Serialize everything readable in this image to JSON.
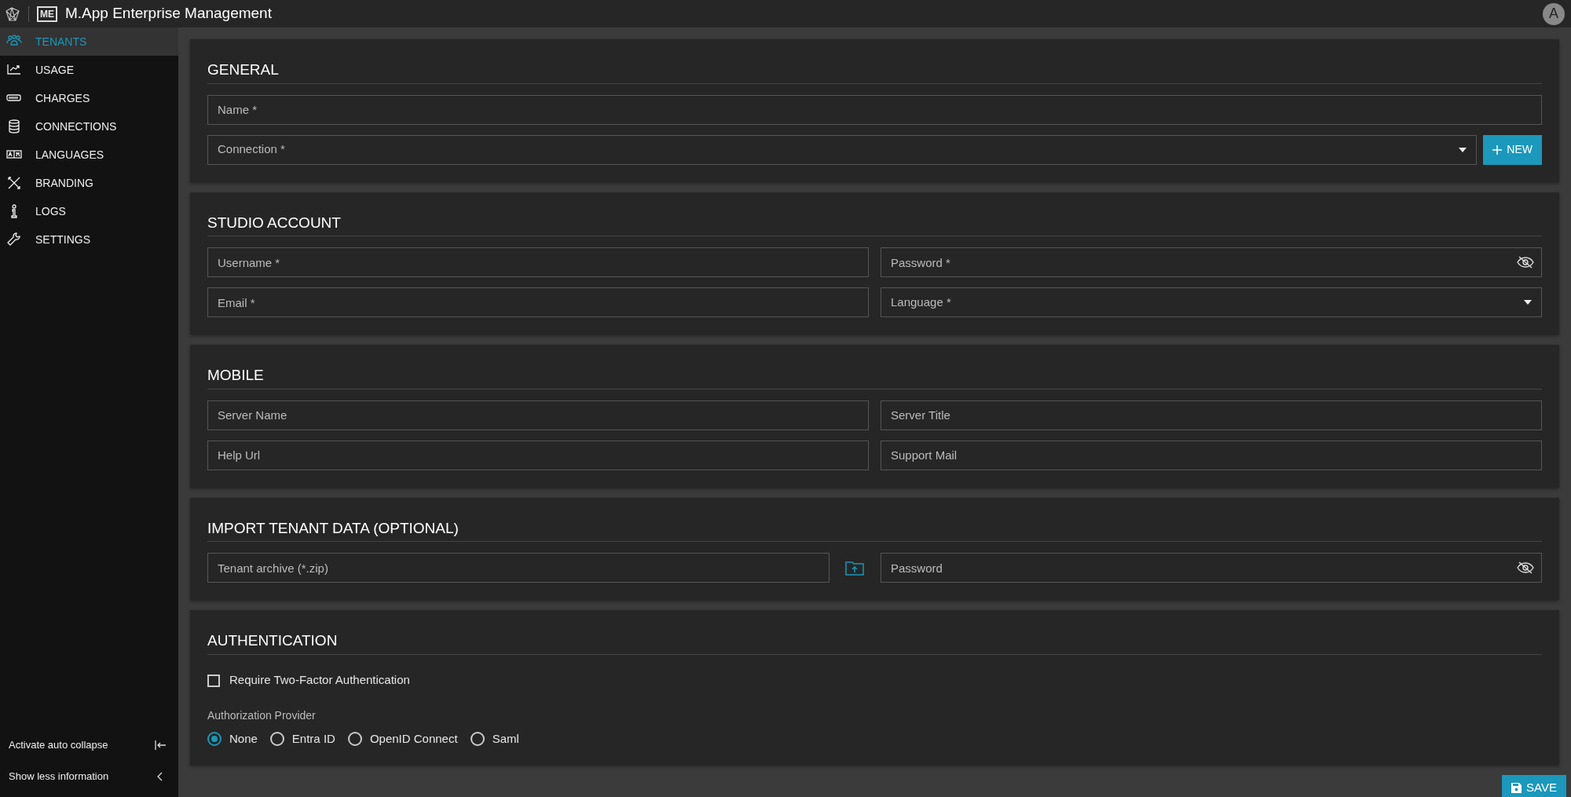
{
  "header": {
    "app_badge": "ME",
    "title": "M.App Enterprise Management",
    "avatar": "A"
  },
  "sidebar": {
    "items": [
      {
        "label": "TENANTS",
        "selected": true
      },
      {
        "label": "USAGE",
        "selected": false
      },
      {
        "label": "CHARGES",
        "selected": false
      },
      {
        "label": "CONNECTIONS",
        "selected": false
      },
      {
        "label": "LANGUAGES",
        "selected": false
      },
      {
        "label": "BRANDING",
        "selected": false
      },
      {
        "label": "LOGS",
        "selected": false
      },
      {
        "label": "SETTINGS",
        "selected": false
      }
    ],
    "footer": [
      {
        "label": "Activate auto collapse"
      },
      {
        "label": "Show less information"
      }
    ]
  },
  "sections": [
    {
      "title": "GENERAL",
      "rows": [
        [
          {
            "kind": "text",
            "placeholder": "Name *"
          }
        ],
        [
          {
            "kind": "select",
            "placeholder": "Connection *"
          },
          {
            "kind": "button",
            "label": "NEW"
          }
        ]
      ]
    },
    {
      "title": "STUDIO ACCOUNT",
      "rows": [
        [
          {
            "kind": "text",
            "placeholder": "Username *"
          },
          {
            "kind": "password",
            "placeholder": "Password *"
          }
        ],
        [
          {
            "kind": "text",
            "placeholder": "Email *"
          },
          {
            "kind": "select",
            "placeholder": "Language *"
          }
        ]
      ]
    },
    {
      "title": "MOBILE",
      "rows": [
        [
          {
            "kind": "text",
            "placeholder": "Server Name"
          },
          {
            "kind": "text",
            "placeholder": "Server Title"
          }
        ],
        [
          {
            "kind": "text",
            "placeholder": "Help Url"
          },
          {
            "kind": "text",
            "placeholder": "Support Mail"
          }
        ]
      ]
    },
    {
      "title": "IMPORT TENANT DATA (OPTIONAL)",
      "rows": [
        [
          {
            "kind": "file",
            "placeholder": "Tenant archive (*.zip)"
          },
          {
            "kind": "password",
            "placeholder": "Password"
          }
        ]
      ]
    },
    {
      "title": "AUTHENTICATION",
      "rows": [
        [
          {
            "kind": "checkbox",
            "label": "Require Two-Factor Authentication",
            "checked": false
          }
        ],
        [
          {
            "kind": "radio_group",
            "label": "Authorization Provider",
            "options": [
              {
                "label": "None",
                "selected": true
              },
              {
                "label": "Entra ID",
                "selected": false
              },
              {
                "label": "OpenID Connect",
                "selected": false
              },
              {
                "label": "Saml",
                "selected": false
              }
            ]
          }
        ]
      ]
    }
  ],
  "save_button": "SAVE"
}
